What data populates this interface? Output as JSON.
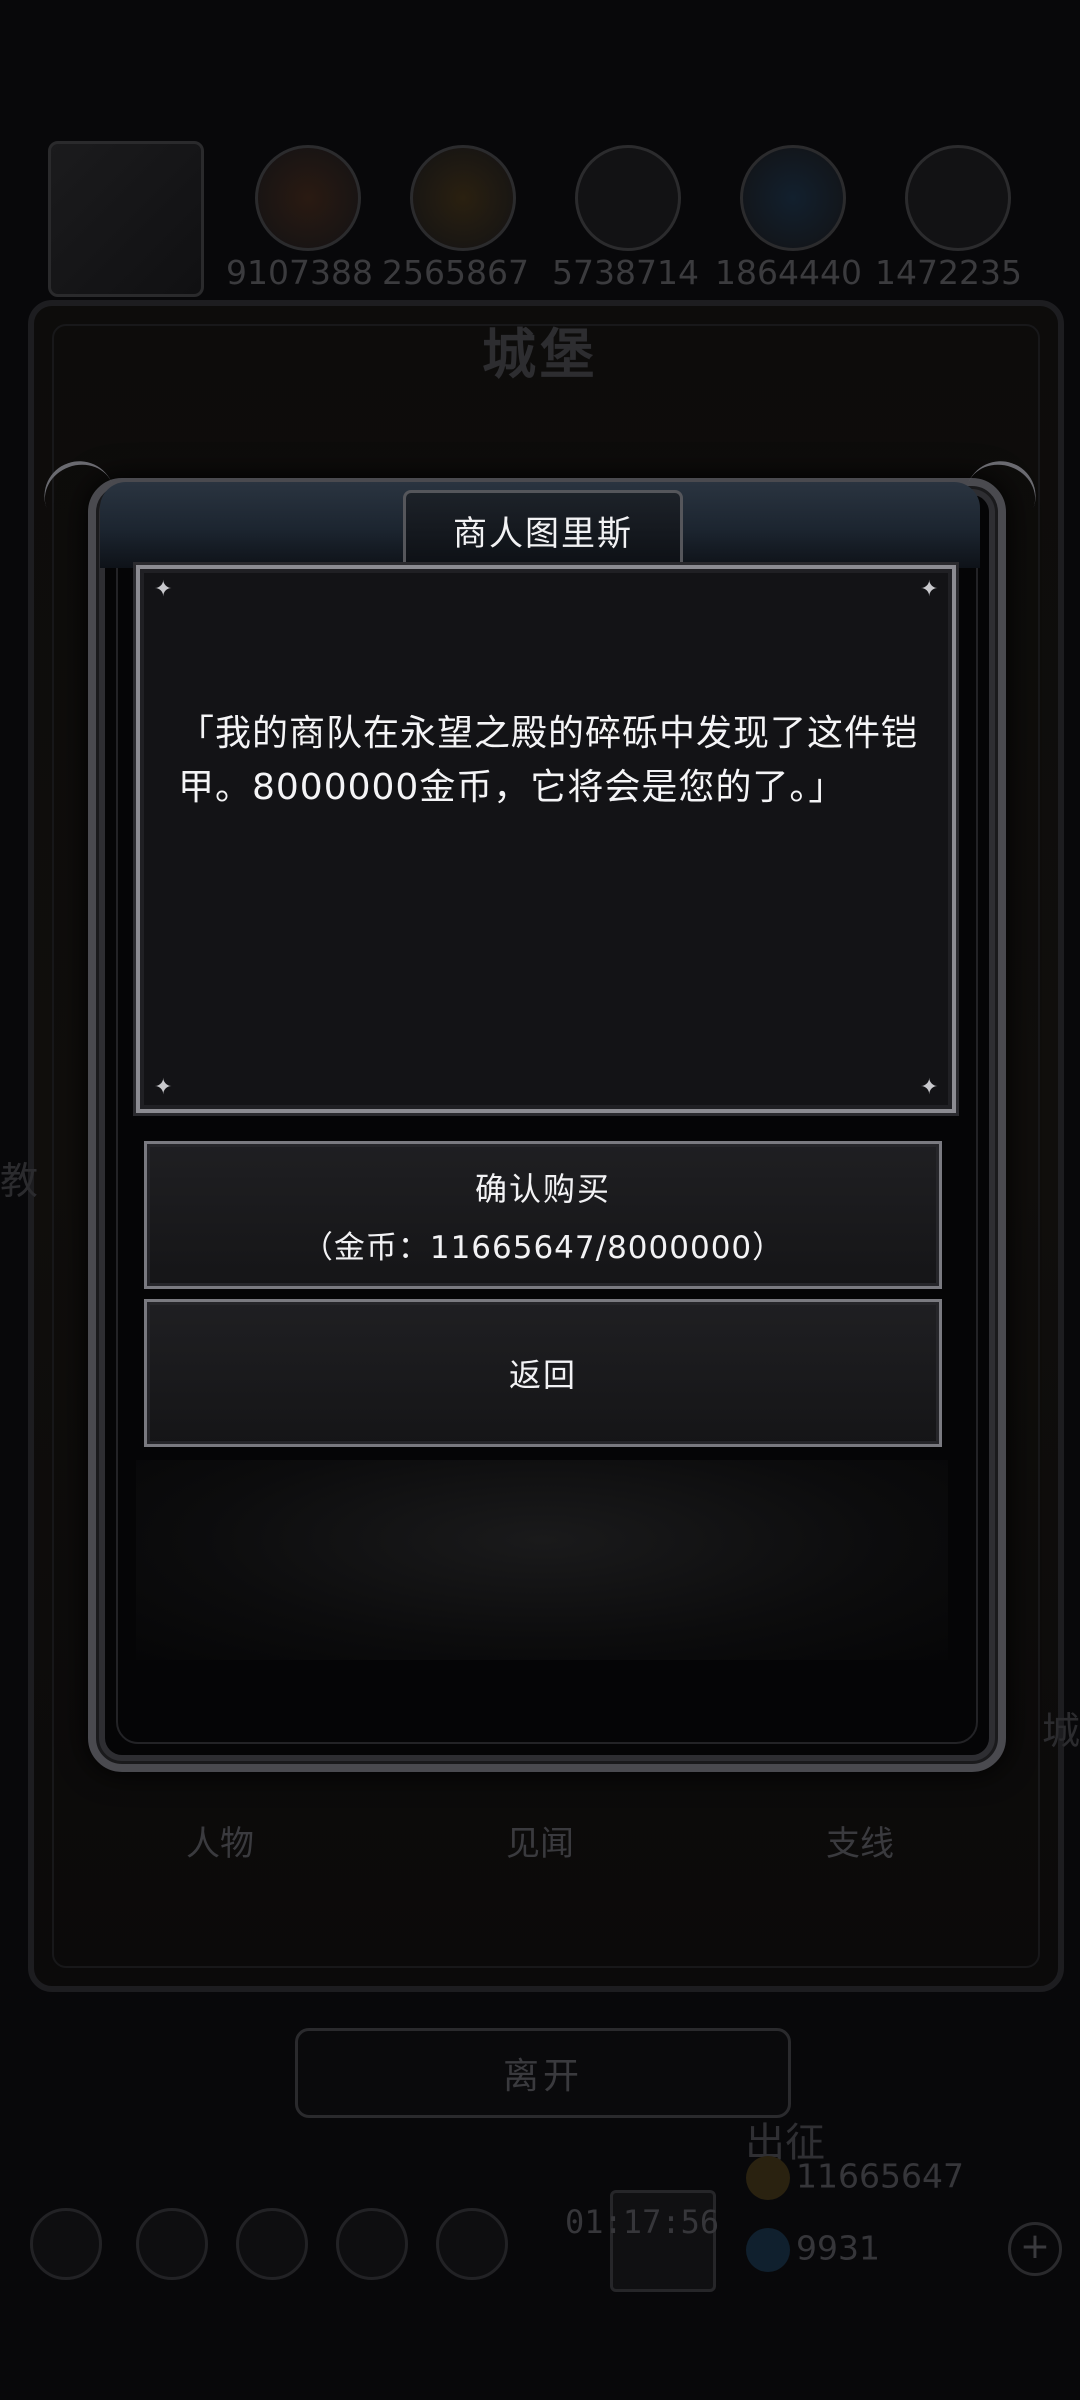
{
  "background": {
    "castle_title": "城堡",
    "resources": [
      {
        "icon": "fire-orb-icon",
        "value": "9107388"
      },
      {
        "icon": "wood-icon",
        "value": "2565867"
      },
      {
        "icon": "stone-icon",
        "value": "5738714"
      },
      {
        "icon": "water-orb-icon",
        "value": "1864440"
      },
      {
        "icon": "iron-icon",
        "value": "1472235"
      }
    ],
    "side_text_left": "教",
    "side_text_right": "城",
    "tabs": [
      "人物",
      "见闻",
      "支线"
    ],
    "leave_button": "离开",
    "expedition_label": "出征",
    "gold": "11665647",
    "gems": "9931",
    "timer": "01:17:56"
  },
  "dialog": {
    "title": "商人图里斯",
    "message": "「我的商队在永望之殿的碎砾中发现了这件铠甲。8000000金币，它将会是您的了。」",
    "confirm_label": "确认购买",
    "confirm_cost": "（金币：11665647/8000000）",
    "back_label": "返回"
  },
  "colors": {
    "accent_gold": "#8a6a2a",
    "gem_blue": "#1f4a6e",
    "frame_silver": "#8c8c92"
  }
}
